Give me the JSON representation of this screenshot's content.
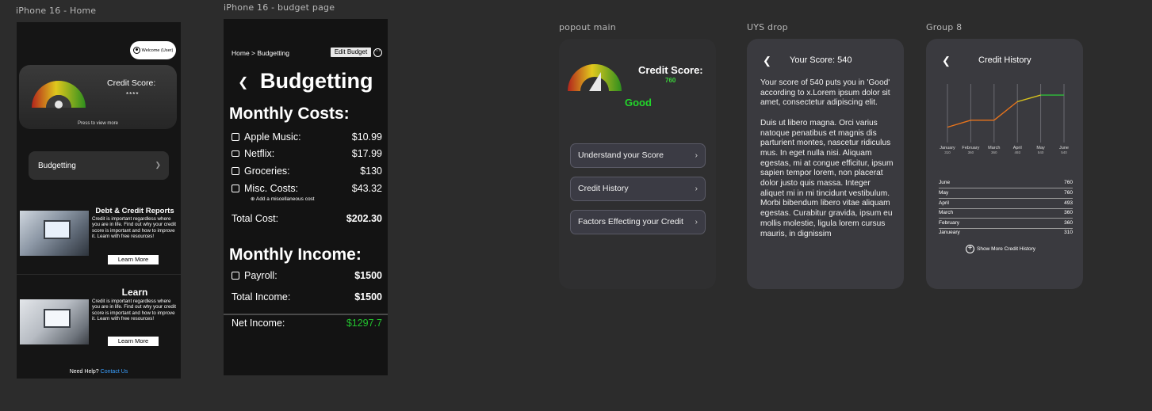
{
  "frames": {
    "home": "iPhone 16 - Home",
    "budget": "iPhone 16 - budget page",
    "popout": "popout main",
    "uys": "UYS drop",
    "group": "Group 8"
  },
  "home": {
    "welcome": "Welcome (User)",
    "credit_label": "Credit Score:",
    "credit_value": "****",
    "press": "Press to view more",
    "budgeting": "Budgetting",
    "articles": [
      {
        "title": "Debt & Credit Reports",
        "body": "Credit is important regardless where you are in life. Find out why your credit score is important and how to improve it. Learn with free resources!",
        "button": "Learn More"
      },
      {
        "title": "Learn",
        "body": "Credit is important regardless where you are in life. Find out why your credit score is important and how to improve it. Learn with free resources!",
        "button": "Learn More"
      }
    ],
    "help": "Need Help?",
    "contact": "Contact Us"
  },
  "budget": {
    "breadcrumb": "Home > Budgetting",
    "edit": "Edit Budget",
    "title": "Budgetting",
    "costs_heading": "Monthly Costs:",
    "costs": [
      {
        "label": "Apple Music:",
        "value": "$10.99"
      },
      {
        "label": "Netflix:",
        "value": "$17.99"
      },
      {
        "label": "Groceries:",
        "value": "$130"
      },
      {
        "label": "Misc. Costs:",
        "value": "$43.32"
      }
    ],
    "add_misc": "Add a miscellaneous cost",
    "total_cost_label": "Total Cost:",
    "total_cost": "$202.30",
    "income_heading": "Monthly Income:",
    "income": [
      {
        "label": "Payroll:",
        "value": "$1500"
      }
    ],
    "total_income_label": "Total Income:",
    "total_income": "$1500",
    "net_label": "Net Income:",
    "net": "$1297.7"
  },
  "popout": {
    "credit_label": "Credit Score:",
    "value": "760",
    "rating": "Good",
    "buttons": [
      "Understand your Score",
      "Credit History",
      "Factors Effecting your Credit"
    ]
  },
  "uys": {
    "title": "Your Score: 540",
    "paragraph1": "Your score of 540 puts you in 'Good' according to x.Lorem ipsum dolor sit amet, consectetur adipiscing elit.",
    "paragraph2": "Duis ut libero magna. Orci varius natoque penatibus et magnis dis parturient montes, nascetur ridiculus mus. In eget nulla nisi. Aliquam egestas, mi at congue efficitur, ipsum sapien tempor lorem, non placerat dolor justo quis massa. Integer aliquet mi in mi tincidunt vestibulum. Morbi bibendum libero vitae aliquam egestas. Curabitur gravida, ipsum eu mollis molestie, ligula lorem cursus mauris, in dignissim"
  },
  "history": {
    "title": "Credit History",
    "table": [
      {
        "month": "June",
        "score": "760"
      },
      {
        "month": "May",
        "score": "760"
      },
      {
        "month": "April",
        "score": "493"
      },
      {
        "month": "March",
        "score": "360"
      },
      {
        "month": "February",
        "score": "360"
      },
      {
        "month": "Janueary",
        "score": "310"
      }
    ],
    "show_more": "Show More Credit History"
  },
  "chart_data": {
    "type": "line",
    "categories": [
      "January",
      "February",
      "March",
      "April",
      "May",
      "June"
    ],
    "tick_values": [
      "310",
      "360",
      "360",
      "493",
      "540",
      "540"
    ],
    "values": [
      310,
      360,
      360,
      493,
      540,
      540
    ],
    "ylim": [
      200,
      620
    ],
    "grid": "vertical",
    "colors": [
      "#e8741c",
      "#e8741c",
      "#e8741c",
      "#d8c21d",
      "#2fbf3a"
    ]
  }
}
